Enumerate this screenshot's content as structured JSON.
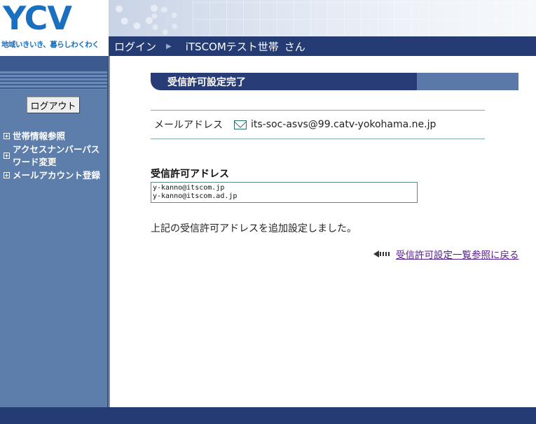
{
  "header": {
    "logo_text": "YCV",
    "slogan": "地域いきいき、暮らしわくわく",
    "nav_login": "ログイン",
    "nav_user": "iTSCOMテスト世帯",
    "nav_suffix": "さん"
  },
  "sidebar": {
    "logout_label": "ログアウト",
    "items": [
      {
        "label": "世帯情報参照"
      },
      {
        "label": "アクセスナンバーパスワード変更"
      },
      {
        "label": "メールアカウント登録"
      }
    ]
  },
  "main": {
    "section_title": "受信許可設定完了",
    "mail_label": "メールアドレス",
    "mail_value": "its-soc-asvs@99.catv-yokohama.ne.jp",
    "allow_label": "受信許可アドレス",
    "allow_addresses": "y-kanno@itscom.jp\ny-kanno@itscom.ad.jp",
    "done_message": "上記の受信許可アドレスを追加設定しました。",
    "back_link": "受信許可設定一覧参照に戻る"
  },
  "colors": {
    "navy": "#243b73",
    "sidebar": "#5d7daa",
    "logo": "#1b6fbf",
    "link_visited": "#551a8b"
  }
}
